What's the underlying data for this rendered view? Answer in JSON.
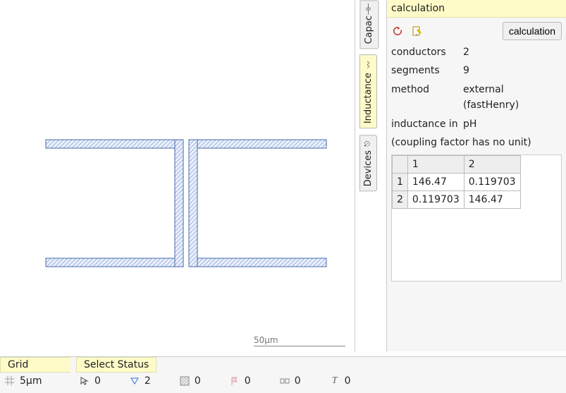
{
  "app": {
    "scale_label": "50µm"
  },
  "tabs": {
    "capac": "Capac",
    "inductance": "Inductance",
    "devices": "Devices"
  },
  "panel": {
    "title": "calculation",
    "calc_button": "calculation",
    "rows": {
      "conductors_k": "conductors",
      "conductors_v": "2",
      "segments_k": "segments",
      "segments_v": "9",
      "method_k": "method",
      "method_v": "external (fastHenry)",
      "unit_k": "inductance in",
      "unit_v": "pH",
      "note": "(coupling factor has no unit)"
    },
    "matrix": {
      "col1": "1",
      "col2": "2",
      "r1": "1",
      "r2": "2",
      "c11": "146.47",
      "c12": "0.119703",
      "c21": "0.119703",
      "c22": "146.47"
    }
  },
  "status": {
    "grid_title": "Grid",
    "select_title": "Select Status",
    "grid_value": "5µm",
    "sel": {
      "v0": "0",
      "v1": "2",
      "v2": "0",
      "v3": "0",
      "v4": "0",
      "v5": "0"
    }
  },
  "chart_data": {
    "type": "table",
    "title": "Inductance / coupling matrix (pH, coupling unitless)",
    "categories": [
      "1",
      "2"
    ],
    "series": [
      {
        "name": "1",
        "values": [
          146.47,
          0.119703
        ]
      },
      {
        "name": "2",
        "values": [
          0.119703,
          146.47
        ]
      }
    ]
  }
}
